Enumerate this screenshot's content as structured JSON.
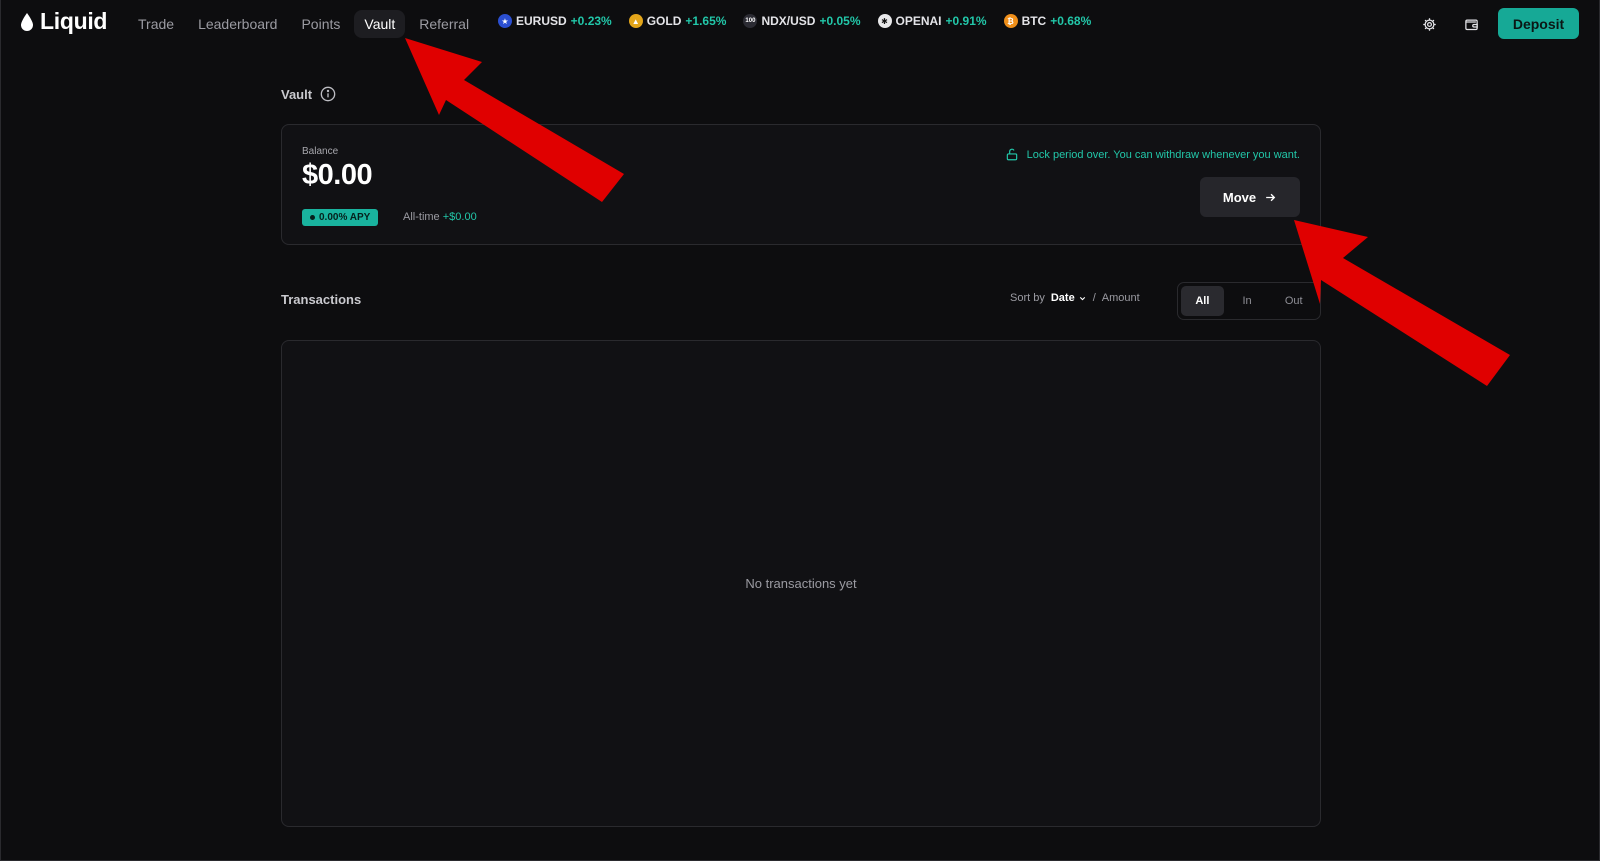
{
  "app": {
    "name": "Liquid"
  },
  "nav": [
    {
      "label": "Trade",
      "active": false
    },
    {
      "label": "Leaderboard",
      "active": false
    },
    {
      "label": "Points",
      "active": false
    },
    {
      "label": "Vault",
      "active": true
    },
    {
      "label": "Referral",
      "active": false
    }
  ],
  "tickers": [
    {
      "symbol": "EURUSD",
      "change": "+0.23%",
      "icon": "eu-flag-icon",
      "color": "#2b4fd1",
      "glyph": "★"
    },
    {
      "symbol": "GOLD",
      "change": "+1.65%",
      "icon": "gold-icon",
      "color": "#e3a51a",
      "glyph": "▲"
    },
    {
      "symbol": "NDX/USD",
      "change": "+0.05%",
      "icon": "ndx-icon",
      "color": "#2b2b33",
      "glyph": "100"
    },
    {
      "symbol": "OPENAI",
      "change": "+0.91%",
      "icon": "openai-icon",
      "color": "#e8e8ea",
      "glyph": "✱"
    },
    {
      "symbol": "BTC",
      "change": "+0.68%",
      "icon": "bitcoin-icon",
      "color": "#f08f1a",
      "glyph": "₿"
    }
  ],
  "header": {
    "deposit_label": "Deposit"
  },
  "vault": {
    "title": "Vault",
    "balance_label": "Balance",
    "balance": "$0.00",
    "apy": "0.00% APY",
    "alltime_label": "All-time",
    "alltime_value": "+$0.00",
    "lock_message": "Lock period over. You can withdraw whenever you want.",
    "move_label": "Move"
  },
  "transactions": {
    "title": "Transactions",
    "sort_by_label": "Sort by",
    "sort_date": "Date",
    "separator": "/",
    "sort_amount": "Amount",
    "filters": [
      {
        "label": "All",
        "active": true
      },
      {
        "label": "In",
        "active": false
      },
      {
        "label": "Out",
        "active": false
      }
    ],
    "empty_text": "No transactions yet"
  },
  "colors": {
    "accent": "#16a996",
    "positive": "#22c7a9",
    "annotation": "#e00000"
  }
}
